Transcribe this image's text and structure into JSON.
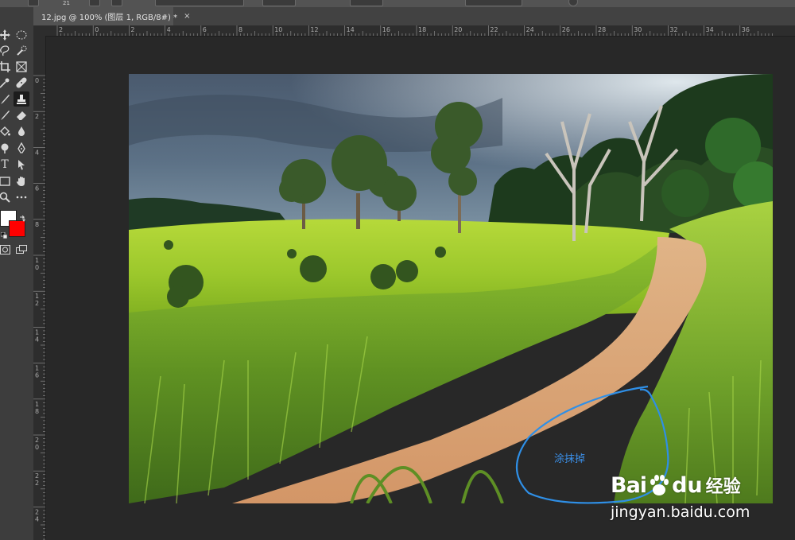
{
  "options_bar": {
    "size_value": "21"
  },
  "document": {
    "tab_title": "12.jpg @ 100% (图层 1, RGB/8#) *",
    "close_glyph": "×"
  },
  "ruler_top": {
    "labels": [
      "2",
      "0",
      "2",
      "4",
      "6",
      "8",
      "10",
      "12",
      "14",
      "16",
      "18",
      "20",
      "22",
      "24",
      "26",
      "28",
      "30",
      "32",
      "34",
      "36"
    ]
  },
  "ruler_left": {
    "labels": [
      "0",
      "2",
      "4",
      "6",
      "8",
      "1 0",
      "1 2",
      "1 4",
      "1 6",
      "1 8",
      "2 0",
      "2 2",
      "2 4"
    ]
  },
  "toolbar": {
    "tools": [
      {
        "name": "move-tool",
        "icon": "move-icon",
        "glyph": "✥"
      },
      {
        "name": "marquee-tool",
        "icon": "ellipse-marquee-icon",
        "glyph": "◌"
      },
      {
        "name": "lasso-tool",
        "icon": "lasso-icon",
        "glyph": "ℓ"
      },
      {
        "name": "quick-select-tool",
        "icon": "quick-select-icon",
        "glyph": "✎"
      },
      {
        "name": "crop-tool",
        "icon": "crop-icon",
        "glyph": "⌗"
      },
      {
        "name": "frame-tool",
        "icon": "frame-icon",
        "glyph": "⊠"
      },
      {
        "name": "eyedropper-tool",
        "icon": "eyedropper-icon",
        "glyph": "✒"
      },
      {
        "name": "healing-tool",
        "icon": "bandage-icon",
        "glyph": "✚"
      },
      {
        "name": "brush-tool",
        "icon": "brush-icon",
        "glyph": "/"
      },
      {
        "name": "clone-stamp-tool",
        "icon": "stamp-icon",
        "glyph": "⊥"
      },
      {
        "name": "history-brush-tool",
        "icon": "history-brush-icon",
        "glyph": "↺"
      },
      {
        "name": "eraser-tool",
        "icon": "eraser-icon",
        "glyph": "◆"
      },
      {
        "name": "paint-bucket-tool",
        "icon": "bucket-icon",
        "glyph": "◈"
      },
      {
        "name": "blur-tool",
        "icon": "droplet-icon",
        "glyph": "●"
      },
      {
        "name": "dodge-tool",
        "icon": "dodge-icon",
        "glyph": "●"
      },
      {
        "name": "pen-tool",
        "icon": "pen-icon",
        "glyph": "✒"
      },
      {
        "name": "type-tool",
        "icon": "type-icon",
        "glyph": "T"
      },
      {
        "name": "path-select-tool",
        "icon": "arrow-icon",
        "glyph": "➤"
      },
      {
        "name": "rectangle-tool",
        "icon": "rectangle-icon",
        "glyph": "▭"
      },
      {
        "name": "hand-tool",
        "icon": "hand-icon",
        "glyph": "✋"
      },
      {
        "name": "zoom-tool",
        "icon": "zoom-icon",
        "glyph": "⚲"
      },
      {
        "name": "more-tools",
        "icon": "ellipsis-icon",
        "glyph": "•••"
      }
    ],
    "foreground_color": "#ffffff",
    "background_color": "#ff0000"
  },
  "annotation": {
    "text": "涂抹掉",
    "color": "#3a8ee6"
  },
  "watermark": {
    "brand_left": "Bai",
    "brand_right": "du",
    "brand_cn": "经验",
    "url": "jingyan.baidu.com"
  }
}
